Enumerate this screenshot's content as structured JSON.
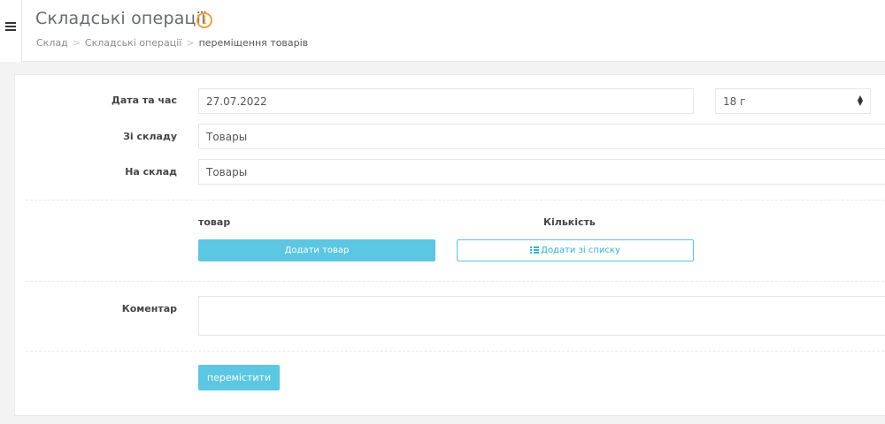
{
  "header": {
    "title": "Складські операції",
    "info_icon": "info-circle-icon",
    "breadcrumb": [
      "Склад",
      "Складські операції",
      "переміщення товарів"
    ],
    "separator": ">"
  },
  "form": {
    "datetime": {
      "label": "Дата та час",
      "date_value": "27.07.2022",
      "hour_value": "18 г"
    },
    "from_warehouse": {
      "label": "Зі складу",
      "value": "Товары"
    },
    "to_warehouse": {
      "label": "На склад",
      "value": "Товары"
    },
    "items": {
      "col_product": "товар",
      "col_quantity": "Кількість",
      "add_product_label": "Додати товар",
      "add_from_list_label": "Додати зі списку"
    },
    "comment": {
      "label": "Коментар",
      "value": ""
    },
    "submit_label": "перемістити"
  },
  "colors": {
    "accent": "#5bc7e3",
    "info": "#f0a13a"
  }
}
